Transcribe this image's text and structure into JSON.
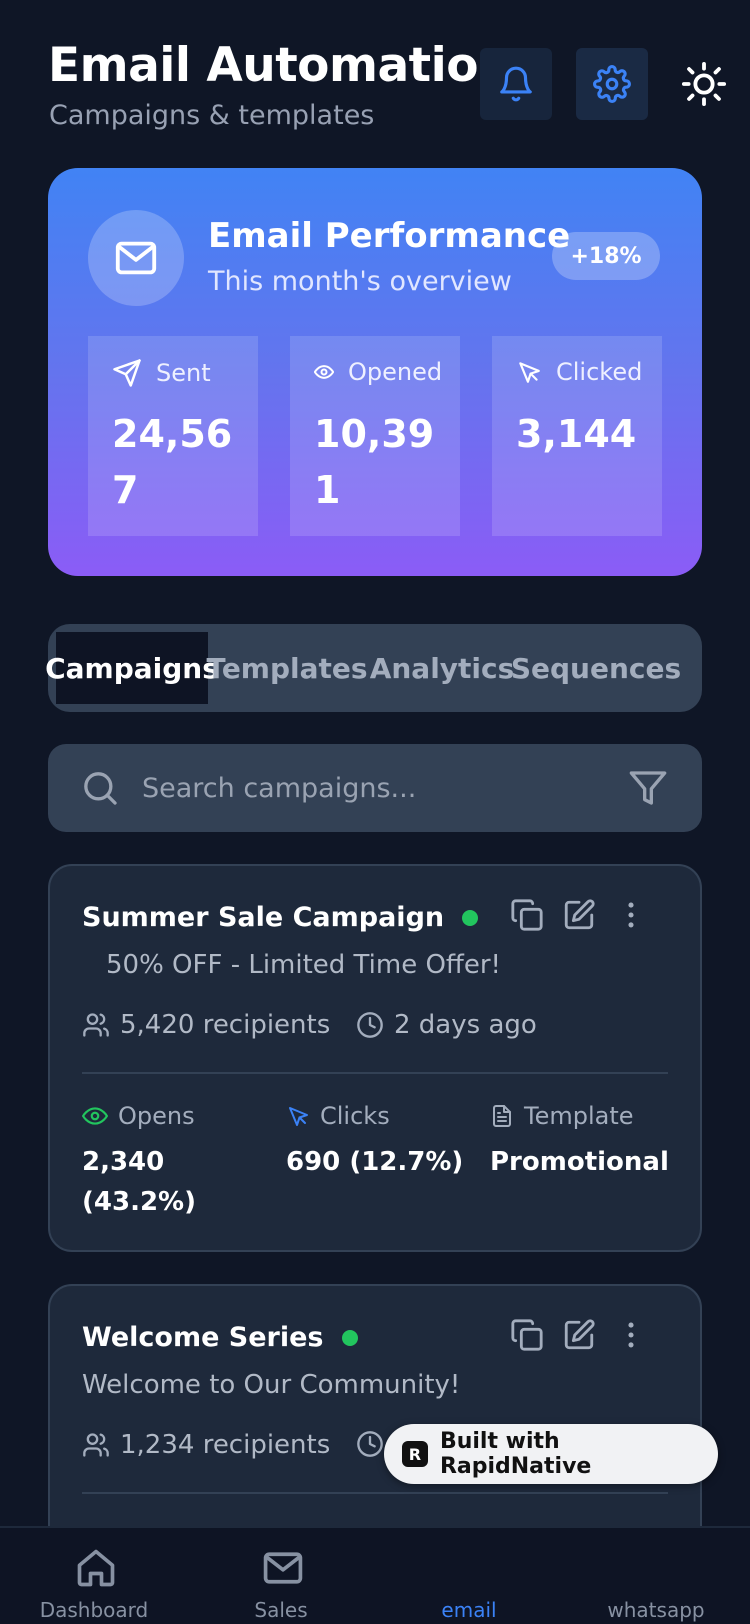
{
  "header": {
    "title": "Email Automation",
    "subtitle": "Campaigns & templates"
  },
  "performance": {
    "title": "Email Performance",
    "subtitle": "This month's overview",
    "badge": "+18%",
    "stats": [
      {
        "label": "Sent",
        "value": "24,567",
        "icon": "send-icon"
      },
      {
        "label": "Opened",
        "value": "10,391",
        "icon": "eye-icon"
      },
      {
        "label": "Clicked",
        "value": "3,144",
        "icon": "cursor-icon"
      }
    ]
  },
  "tabs": [
    {
      "label": "Campaigns",
      "active": true
    },
    {
      "label": "Templates",
      "active": false
    },
    {
      "label": "Analytics",
      "active": false
    },
    {
      "label": "Sequences",
      "active": false
    }
  ],
  "search": {
    "placeholder": "Search campaigns..."
  },
  "campaigns": [
    {
      "name": "Summer Sale Campaign",
      "subject": "50% OFF - Limited Time Offer!",
      "recipients": "5,420 recipients",
      "time": "2 days ago",
      "opens_label": "Opens",
      "opens_value": "2,340 (43.2%)",
      "clicks_label": "Clicks",
      "clicks_value": "690 (12.7%)",
      "template_label": "Template",
      "template_value": "Promotional"
    },
    {
      "name": "Welcome Series",
      "subject": "Welcome to Our Community!",
      "recipients": "1,234 recipients"
    }
  ],
  "badge": {
    "text": "Built with RapidNative"
  },
  "nav": [
    {
      "label": "Dashboard"
    },
    {
      "label": "Sales"
    },
    {
      "label": "email"
    },
    {
      "label": "whatsapp"
    }
  ],
  "colors": {
    "background": "#0f1626",
    "accent": "#3b82f6",
    "active_dot": "#22c55e",
    "gradient_top": "#4183f4",
    "gradient_bottom": "#8b5cf6"
  }
}
